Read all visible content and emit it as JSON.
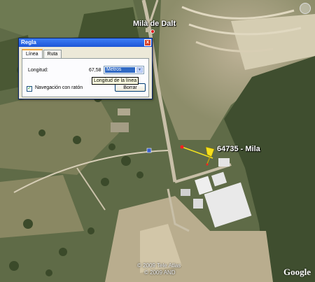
{
  "map": {
    "place_top": "Milà de Dalt",
    "placemark_label": "64735 - Mila",
    "copyright_1": "© 2009 Tele Atlas",
    "copyright_2": "© 2009 AND",
    "logo": "Google",
    "ruler_color": "#f0e020"
  },
  "dialog": {
    "title": "Regla",
    "close_glyph": "x",
    "tabs": [
      {
        "label": "Línea",
        "active": true
      },
      {
        "label": "Ruta",
        "active": false
      }
    ],
    "length_label": "Longitud:",
    "length_value": "67,58",
    "units_selected": "Metros",
    "tooltip": "Longitud de la línea",
    "nav_mouse_checked": true,
    "nav_mouse_label": "Navegación con ratón",
    "clear_button": "Borrar"
  }
}
